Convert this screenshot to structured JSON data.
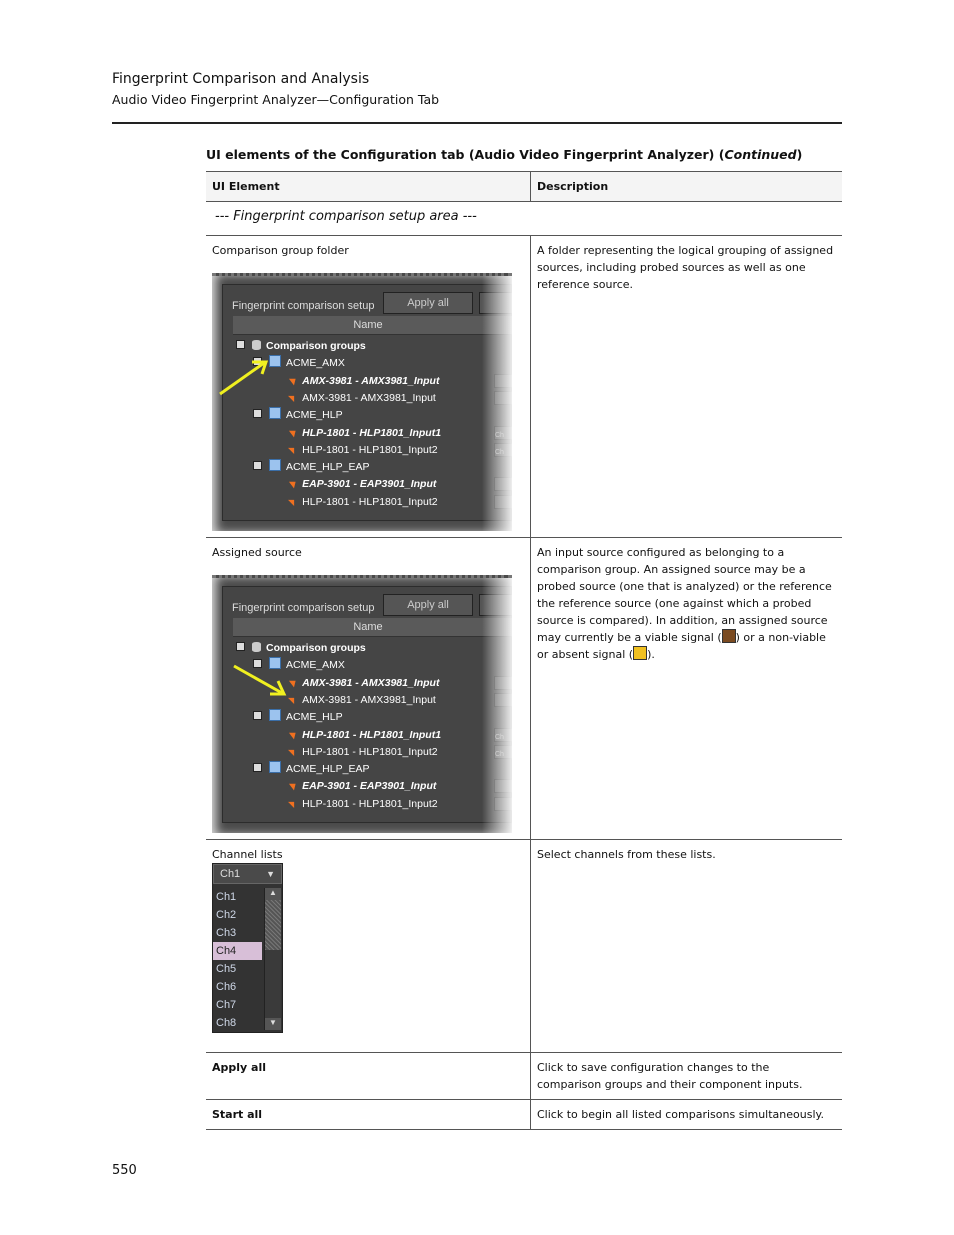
{
  "header": {
    "chapter": "Fingerprint Comparison and Analysis",
    "section": "Audio Video Fingerprint Analyzer—Configuration Tab"
  },
  "table_title": "UI elements of the Configuration tab (Audio Video Fingerprint Analyzer) (",
  "table_title_cont": "Continued",
  "table_title_end": ")",
  "columns": [
    "UI Element",
    "Description"
  ],
  "section_row": "--- Fingerprint comparison setup area ---",
  "rows": [
    {
      "element": "Comparison group folder",
      "description": "A folder representing the logical grouping of assigned sources, including probed sources as well as one reference source."
    },
    {
      "element": "Assigned source",
      "description_parts": [
        "An input source configured as belonging to a comparison group. An assigned source may be a probed source (one that is analyzed) or the reference the reference source (one against which a probed source is compared). In addition, an assigned source may currently be a viable signal (",
        ") or a non-viable or absent signal (",
        ")."
      ]
    },
    {
      "element": "Channel lists",
      "description": "Select channels from these lists."
    },
    {
      "element": "Apply all",
      "description": "Click to save configuration changes to the comparison groups and their component inputs."
    },
    {
      "element": "Start all",
      "description": "Click to begin all listed comparisons simultaneously."
    }
  ],
  "screenshot": {
    "title": "Fingerprint comparison setup",
    "apply_button": "Apply all",
    "name_column": "Name",
    "root": "Comparison groups",
    "groups": [
      {
        "name": "ACME_AMX",
        "sources": [
          {
            "label": "AMX-3981 - AMX3981_Input",
            "italic": true
          },
          {
            "label": "AMX-3981 - AMX3981_Input",
            "italic": false
          }
        ]
      },
      {
        "name": "ACME_HLP",
        "sources": [
          {
            "label": "HLP-1801 - HLP1801_Input1",
            "italic": true
          },
          {
            "label": "HLP-1801 - HLP1801_Input2",
            "italic": false
          }
        ]
      },
      {
        "name": "ACME_HLP_EAP",
        "sources": [
          {
            "label": "EAP-3901 - EAP3901_Input",
            "italic": true
          },
          {
            "label": "HLP-1801 - HLP1801_Input2",
            "italic": false
          }
        ]
      }
    ],
    "ch_stub": "Ch",
    "arrow_color": "#f0f020"
  },
  "channel_list": {
    "selected": "Ch1",
    "items": [
      "Ch1",
      "Ch2",
      "Ch3",
      "Ch4",
      "Ch5",
      "Ch6",
      "Ch7",
      "Ch8"
    ],
    "highlighted": "Ch4",
    "highlight_color": "#d8bfd8"
  },
  "page_number": "550"
}
